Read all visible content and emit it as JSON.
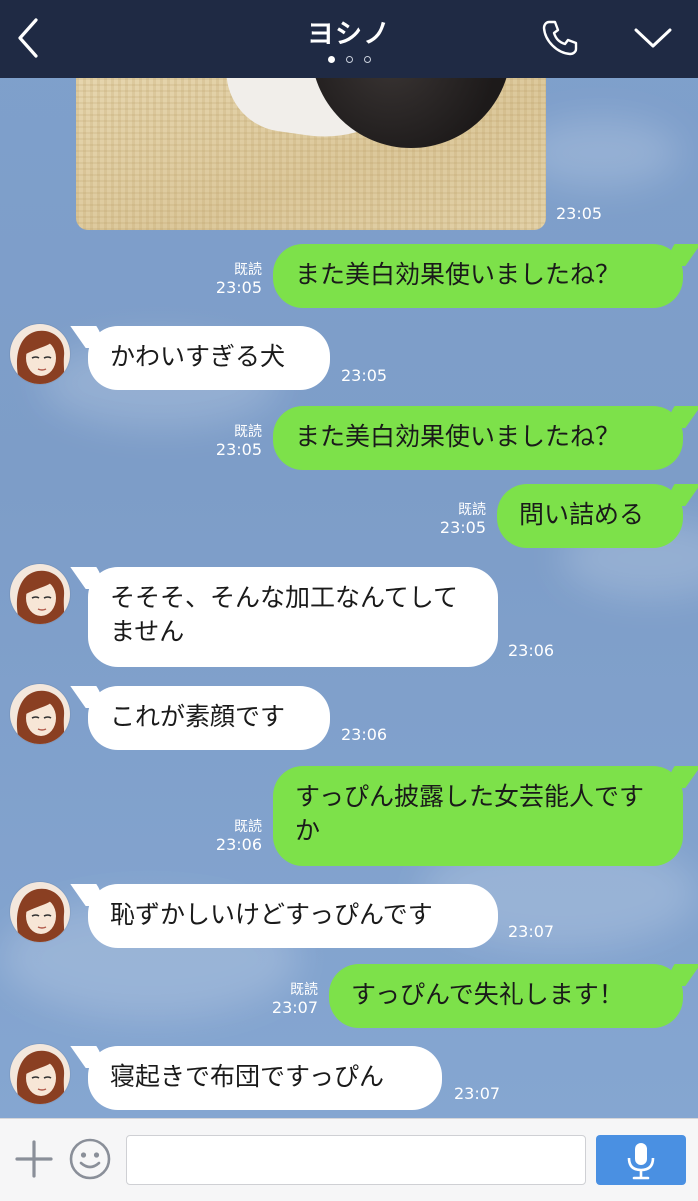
{
  "header": {
    "title": "ヨシノ",
    "page_indicator": {
      "count": 3,
      "active": 0
    }
  },
  "icons": {
    "back": "chevron-left-icon",
    "call": "phone-icon",
    "menu": "chevron-down-icon",
    "add": "plus-icon",
    "emoji": "smiley-icon",
    "voice": "microphone-icon"
  },
  "messages": [
    {
      "type": "image",
      "side": "in",
      "time": "23:05"
    },
    {
      "side": "out",
      "text": "また美白効果使いましたね？",
      "read": "既読",
      "time": "23:05"
    },
    {
      "side": "in",
      "text": "かわいすぎる犬",
      "time": "23:05"
    },
    {
      "side": "out",
      "text": "また美白効果使いましたね？",
      "read": "既読",
      "time": "23:05"
    },
    {
      "side": "out",
      "text": "問い詰める",
      "read": "既読",
      "time": "23:05"
    },
    {
      "side": "in",
      "text": "そそそ、そんな加工なんてしてません",
      "time": "23:06"
    },
    {
      "side": "in",
      "text": "これが素顔です",
      "time": "23:06"
    },
    {
      "side": "out",
      "text": "すっぴん披露した女芸能人ですか",
      "read": "既読",
      "time": "23:06"
    },
    {
      "side": "in",
      "text": "恥ずかしいけどすっぴんです",
      "time": "23:07"
    },
    {
      "side": "out",
      "text": "すっぴんで失礼します！",
      "read": "既読",
      "time": "23:07"
    },
    {
      "side": "in",
      "text": "寝起きで布団ですっぴん",
      "time": "23:07"
    }
  ],
  "input": {
    "value": "",
    "placeholder": ""
  },
  "colors": {
    "header_bg": "#1f2a44",
    "outgoing_bubble": "#7de14a",
    "incoming_bubble": "#ffffff",
    "mic_button": "#4a90e2",
    "chat_bg": "#7fa0cc"
  }
}
